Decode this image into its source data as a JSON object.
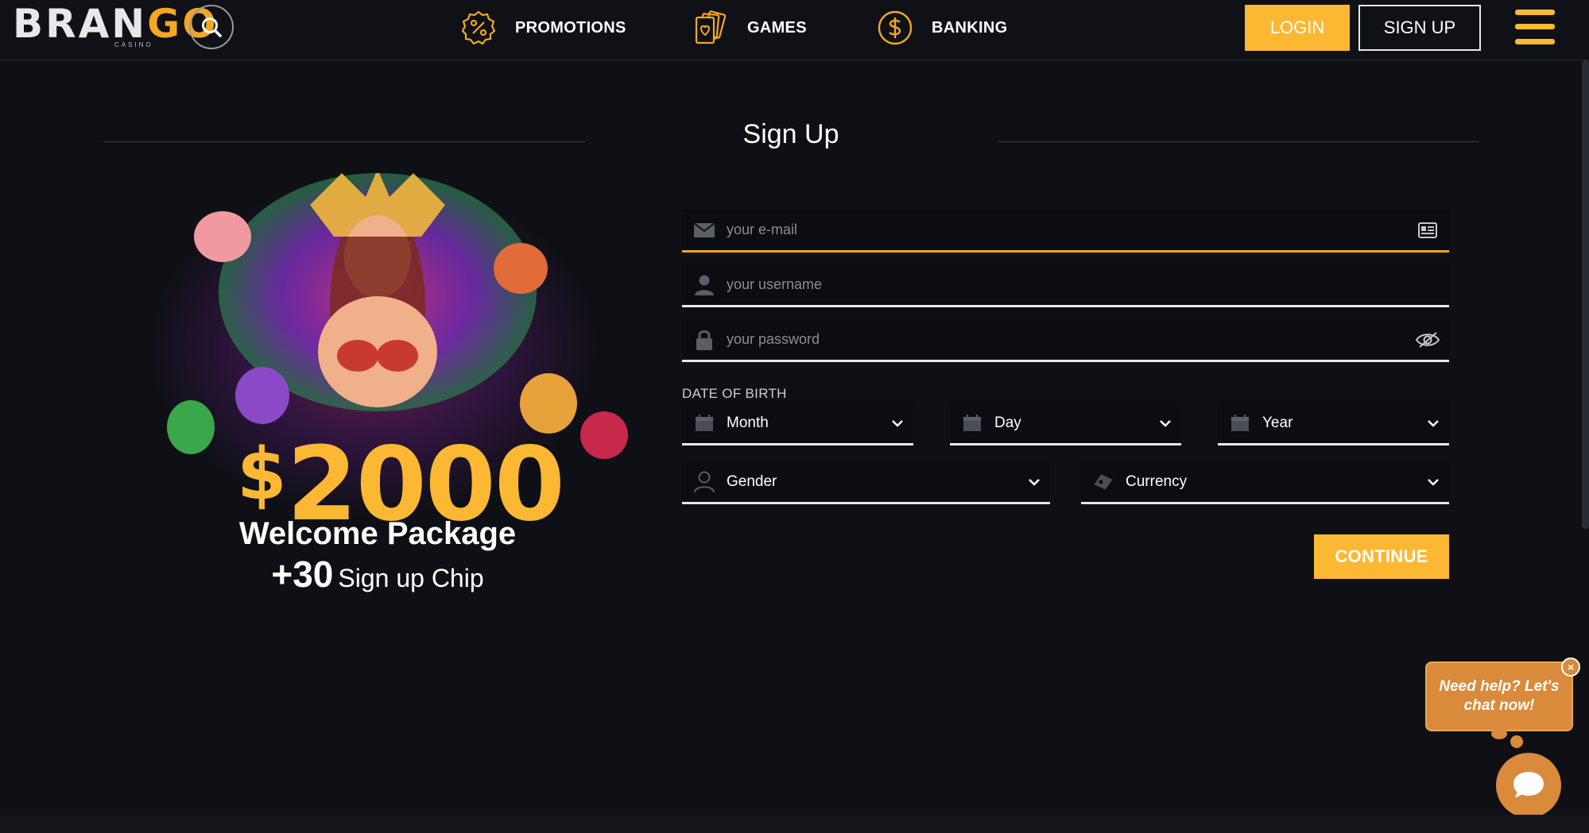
{
  "brand": {
    "logo_main_a": "BRAN",
    "logo_main_b": "GO",
    "logo_sub": "CASINO"
  },
  "nav": {
    "promotions": "PROMOTIONS",
    "games": "GAMES",
    "banking": "BANKING",
    "login": "LOGIN",
    "signup": "SIGN UP"
  },
  "page": {
    "title": "Sign Up"
  },
  "promo": {
    "currency": "$",
    "amount": "2000",
    "welcome": "Welcome Package",
    "bonus": "+30",
    "bonus_label": "Sign up Chip"
  },
  "form": {
    "email_placeholder": "your e-mail",
    "username_placeholder": "your username",
    "password_placeholder": "your password",
    "dob_label": "DATE OF BIRTH",
    "month": "Month",
    "day": "Day",
    "year": "Year",
    "gender": "Gender",
    "currency": "Currency",
    "continue": "CONTINUE"
  },
  "chat": {
    "message": "Need help? Let's chat now!",
    "close": "×"
  },
  "colors": {
    "accent": "#fdb833",
    "background": "#0e1015",
    "chat": "#d98a3a"
  }
}
